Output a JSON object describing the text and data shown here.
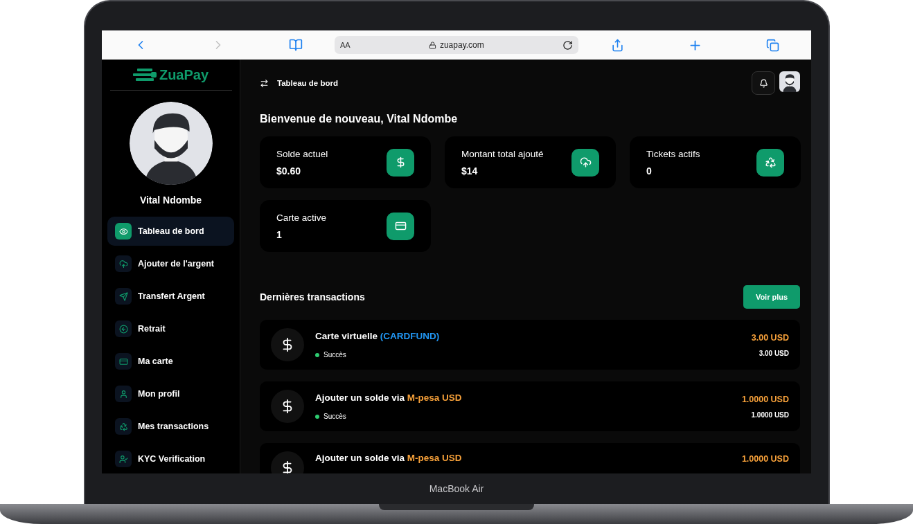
{
  "device": {
    "label": "MacBook Air"
  },
  "browser": {
    "text_size": "AA",
    "url": "zuapay.com",
    "forward_disabled": true
  },
  "sidebar": {
    "logo": "ZuaPay",
    "user_name": "Vital Ndombe",
    "items": [
      {
        "label": "Tableau de bord",
        "selected": true
      },
      {
        "label": "Ajouter de l'argent",
        "selected": false
      },
      {
        "label": "Transfert Argent",
        "selected": false
      },
      {
        "label": "Retrait",
        "selected": false
      },
      {
        "label": "Ma carte",
        "selected": false
      },
      {
        "label": "Mon profil",
        "selected": false
      },
      {
        "label": "Mes transactions",
        "selected": false
      },
      {
        "label": "KYC Verification",
        "selected": false
      }
    ]
  },
  "header": {
    "title": "Tableau de bord"
  },
  "welcome": "Bienvenue de nouveau, Vital Ndombe",
  "stats": [
    {
      "label": "Solde actuel",
      "value": "$0.60"
    },
    {
      "label": "Montant total ajouté",
      "value": "$14"
    },
    {
      "label": "Tickets actifs",
      "value": "0"
    },
    {
      "label": "Carte active",
      "value": "1"
    }
  ],
  "transactions": {
    "title": "Dernières transactions",
    "more_button": "Voir plus",
    "rows": [
      {
        "title": "Carte virtuelle",
        "accent": "(CARDFUND)",
        "color": "#2196f3",
        "status": "Succès",
        "amount": "3.00 USD",
        "amount_sub": "3.00 USD"
      },
      {
        "title": "Ajouter un solde via",
        "accent": "M-pesa USD",
        "color": "#f7a13a",
        "status": "Succès",
        "amount": "1.0000 USD",
        "amount_sub": "1.0000 USD"
      },
      {
        "title": "Ajouter un solde via",
        "accent": "M-pesa USD",
        "color": "#f7a13a",
        "amount": "1.0000 USD"
      }
    ]
  }
}
